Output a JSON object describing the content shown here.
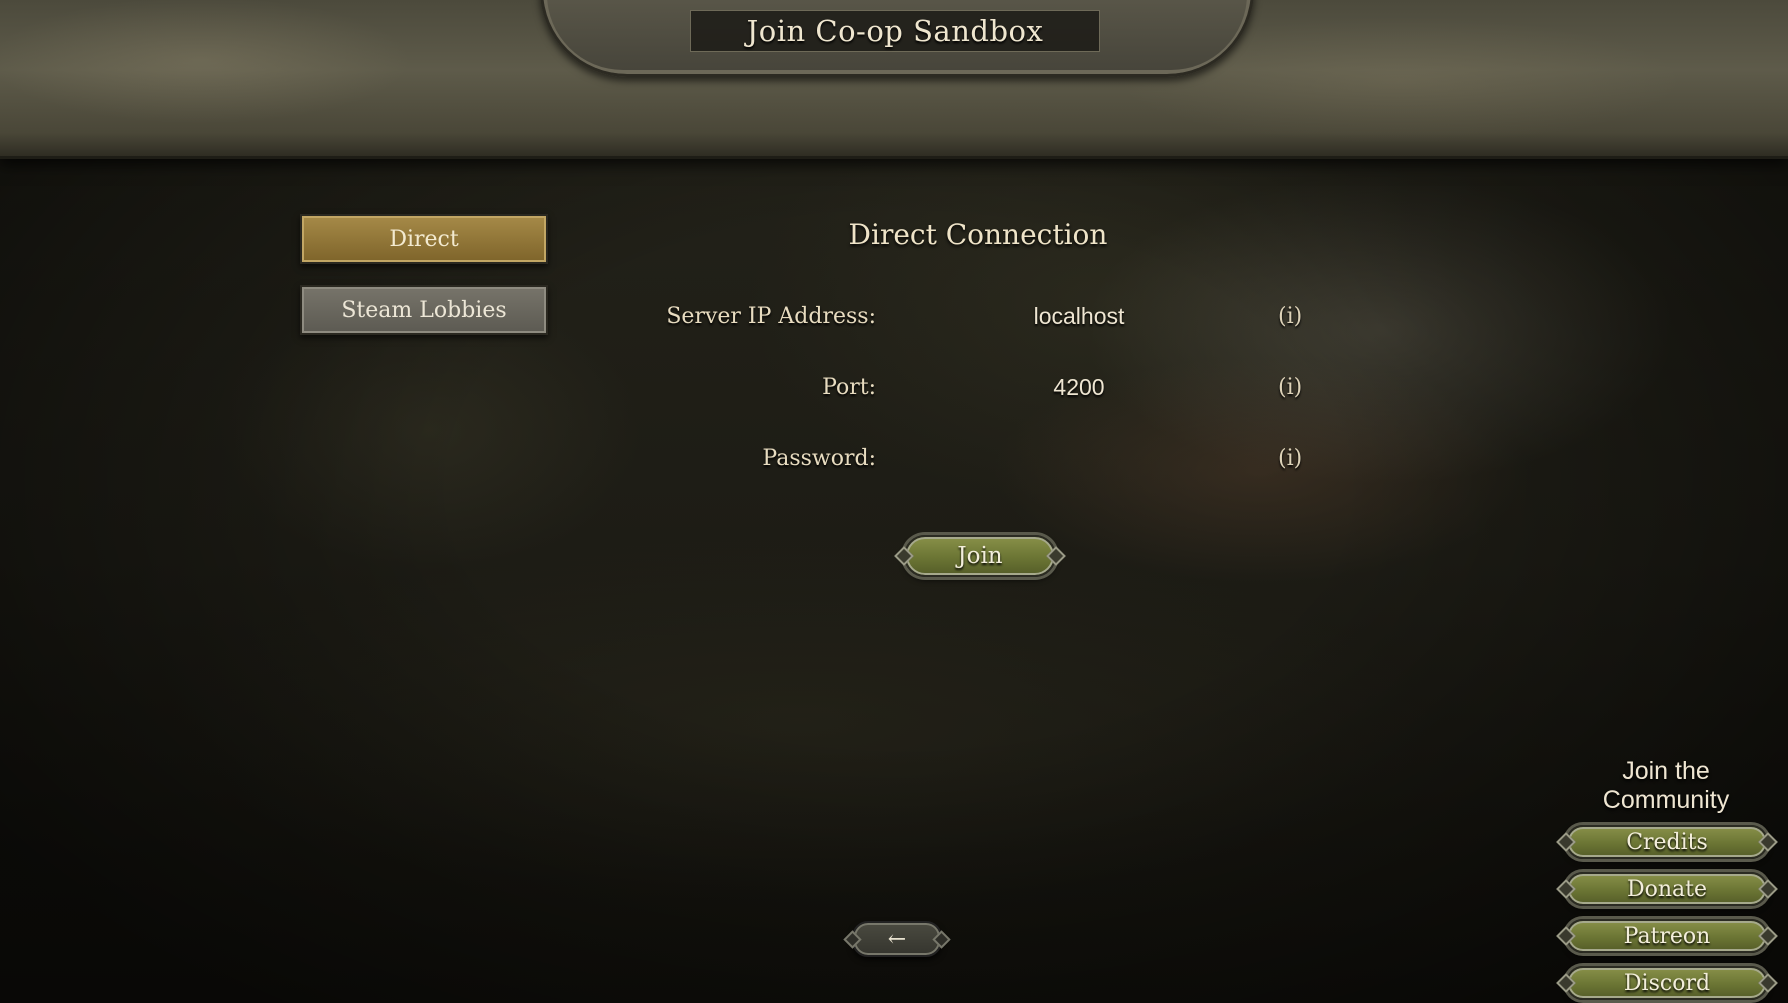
{
  "header": {
    "title": "Join Co-op Sandbox"
  },
  "tabs": [
    {
      "label": "Direct",
      "selected": true
    },
    {
      "label": "Steam Lobbies",
      "selected": false
    }
  ],
  "connection": {
    "title": "Direct Connection",
    "server_ip": {
      "label": "Server IP Address:",
      "value": "localhost",
      "info": "(i)"
    },
    "port": {
      "label": "Port:",
      "value": "4200",
      "info": "(i)"
    },
    "password": {
      "label": "Password:",
      "value": "",
      "info": "(i)"
    },
    "join_label": "Join"
  },
  "navigation": {
    "back_label": "←"
  },
  "community": {
    "title": "Join the Community",
    "buttons": [
      "Credits",
      "Donate",
      "Patreon",
      "Discord"
    ]
  },
  "colors": {
    "selected_tab": "#a68a48",
    "unselected_tab": "#77746a",
    "button_green": "#6b7534"
  }
}
